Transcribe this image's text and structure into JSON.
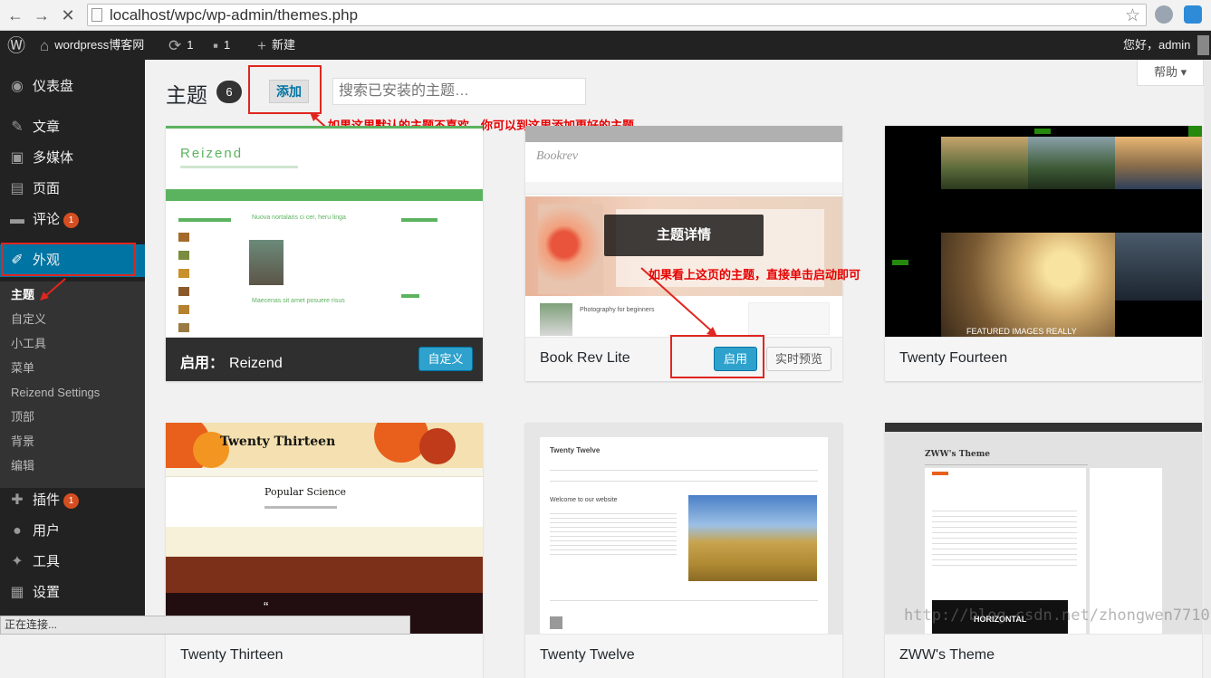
{
  "browser": {
    "url": "localhost/wpc/wp-admin/themes.php",
    "status_text": "正在连接..."
  },
  "adminbar": {
    "site_name": "wordpress博客网",
    "updates_count": "1",
    "comments_count": "1",
    "new_label": "新建",
    "greeting": "您好，admin"
  },
  "sidebar": {
    "items": [
      {
        "label": "仪表盘",
        "icon": "dashboard-icon"
      },
      {
        "label": "文章",
        "icon": "pin-icon"
      },
      {
        "label": "多媒体",
        "icon": "media-icon"
      },
      {
        "label": "页面",
        "icon": "page-icon"
      },
      {
        "label": "评论",
        "icon": "comment-icon",
        "badge": "1"
      },
      {
        "label": "外观",
        "icon": "appearance-icon"
      },
      {
        "label": "插件",
        "icon": "plugin-icon",
        "badge": "1"
      },
      {
        "label": "用户",
        "icon": "user-icon"
      },
      {
        "label": "工具",
        "icon": "tools-icon"
      },
      {
        "label": "设置",
        "icon": "settings-icon"
      }
    ],
    "submenu": [
      "主题",
      "自定义",
      "小工具",
      "菜单",
      "Reizend Settings",
      "顶部",
      "背景",
      "编辑"
    ]
  },
  "page": {
    "title": "主题",
    "theme_count": "6",
    "add_label": "添加",
    "search_placeholder": "搜索已安装的主题…",
    "help_label": "帮助"
  },
  "annotations": {
    "add_note": "如果这里默认的主题不喜欢，你可以到这里添加更好的主题",
    "activate_note": "如果看上这页的主题，直接单击启动即可"
  },
  "themes": [
    {
      "name": "Reizend",
      "active_prefix": "启用：",
      "button": "自定义",
      "active": true
    },
    {
      "name": "Book Rev Lite",
      "overlay": "主题详情",
      "activate": "启用",
      "preview": "实时预览"
    },
    {
      "name": "Twenty Fourteen"
    },
    {
      "name": "Twenty Thirteen"
    },
    {
      "name": "Twenty Twelve"
    },
    {
      "name": "ZWW's Theme"
    }
  ],
  "previews": {
    "reizend_logo": "Reizend",
    "reizend_post1": "Nuova nortalaris ci cer, heru linga",
    "reizend_post2": "Maecenas sit amet posuere risus",
    "bookrev_logo": "Bookrev",
    "bookrev_post": "Photography for beginners",
    "tf_post": "FEATURED IMAGES REALLY",
    "tt_title": "Twenty Thirteen",
    "tt_post": "Popular Science",
    "tw_title": "Twenty Twelve",
    "tw_welcome": "Welcome to our website",
    "zww_title": "ZWW's Theme",
    "zww_horizontal": "HORIZONTAL"
  },
  "watermark": "http://blog.csdn.net/zhongwen7710",
  "colors": {
    "accent": "#0074a2",
    "annotation": "#e60000",
    "badge": "#d54e21"
  }
}
